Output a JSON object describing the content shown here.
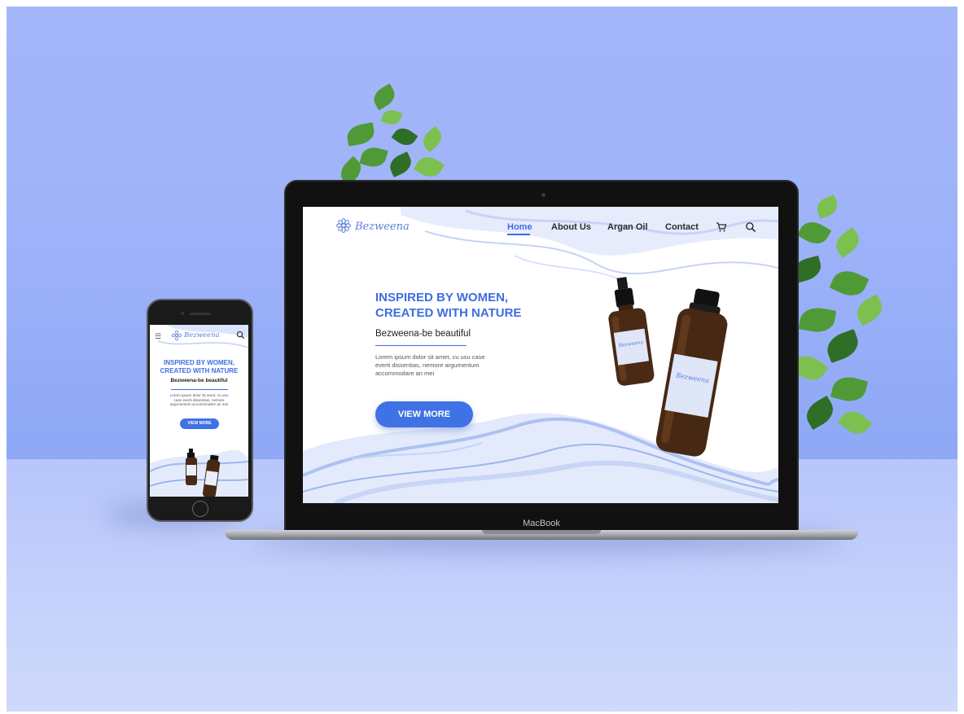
{
  "desktop": {
    "logo_text": "Bezweena",
    "nav": [
      {
        "label": "Home",
        "active": true
      },
      {
        "label": "About Us",
        "active": false
      },
      {
        "label": "Argan Oil",
        "active": false
      },
      {
        "label": "Contact",
        "active": false
      }
    ],
    "icons": [
      "cart-icon",
      "search-icon"
    ],
    "hero": {
      "title_line1": "INSPIRED BY WOMEN,",
      "title_line2": "CREATED WITH NATURE",
      "subtitle": "Bezweena-be beautiful",
      "body_line1": "Lorem ipsum dolor sit amet, cu usu case",
      "body_line2": "everti dissentias, nemore argumentum",
      "body_line3": "accommodare an mei",
      "cta_label": "VIEW MORE"
    },
    "product_label": "Bezweena",
    "device_label": "MacBook"
  },
  "mobile": {
    "logo_text": "Bezweena",
    "icons": [
      "menu-icon",
      "search-icon"
    ],
    "hero": {
      "title_line1": "INSPIRED BY WOMEN,",
      "title_line2": "CREATED WITH NATURE",
      "subtitle": "Bezweena-be beautiful",
      "body_line1": "Lorem ipsum dolor sit amet, cu usu",
      "body_line2": "case everti dissentias, nemore",
      "body_line3": "argumentum accommodare an mei",
      "cta_label": "VIEW MORE"
    }
  },
  "colors": {
    "brand_blue": "#3d6ee0",
    "button_blue": "#3f72e4",
    "background": "#a4b6fa"
  }
}
